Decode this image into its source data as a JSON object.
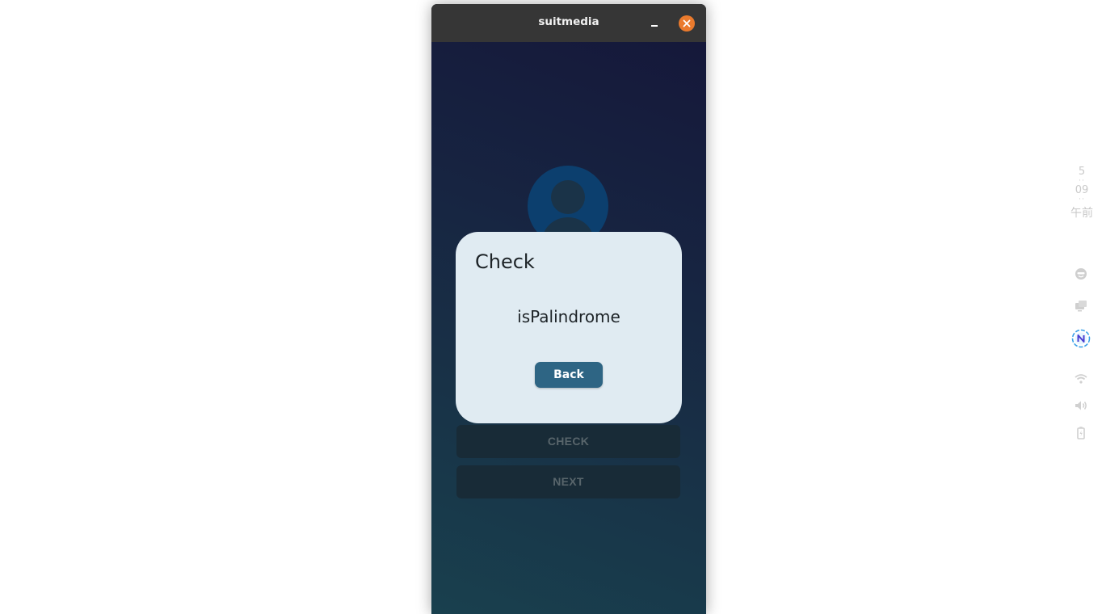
{
  "window": {
    "title": "suitmedia"
  },
  "app": {
    "buttons": {
      "check": "CHECK",
      "next": "NEXT"
    }
  },
  "dialog": {
    "title": "Check",
    "message": "isPalindrome",
    "back_label": "Back"
  },
  "tray": {
    "clock": {
      "hour": "5",
      "minute": "09",
      "ampm": "午前"
    },
    "icons": [
      "emoji-icon",
      "screen-icon",
      "n-app-icon",
      "wifi-icon",
      "volume-icon",
      "battery-icon"
    ]
  },
  "colors": {
    "titlebar": "#363636",
    "close_button": "#ea7a2d",
    "dialog_background": "#e0ebf2",
    "back_button": "#2e6584"
  }
}
